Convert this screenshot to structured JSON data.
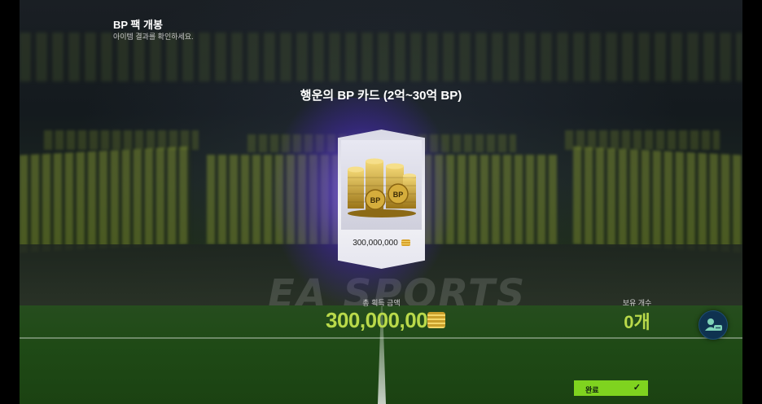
{
  "header": {
    "title": "BP 팩 개봉",
    "subtitle": "아이템 결과를 확인하세요."
  },
  "card": {
    "title": "행운의 BP 카드 (2억~30억 BP)",
    "amount": "300,000,000",
    "coin_label": "BP"
  },
  "summary": {
    "total_label": "총 획득 금액",
    "total_value": "300,000,000",
    "owned_label": "보유 개수",
    "owned_value": "0개"
  },
  "buttons": {
    "done_label": "완료"
  },
  "background": {
    "sponsor": "EA SPORTS"
  },
  "colors": {
    "accent_green": "#b9d94a",
    "button_green": "#7fd31f",
    "glow_purple": "#7850ff"
  }
}
